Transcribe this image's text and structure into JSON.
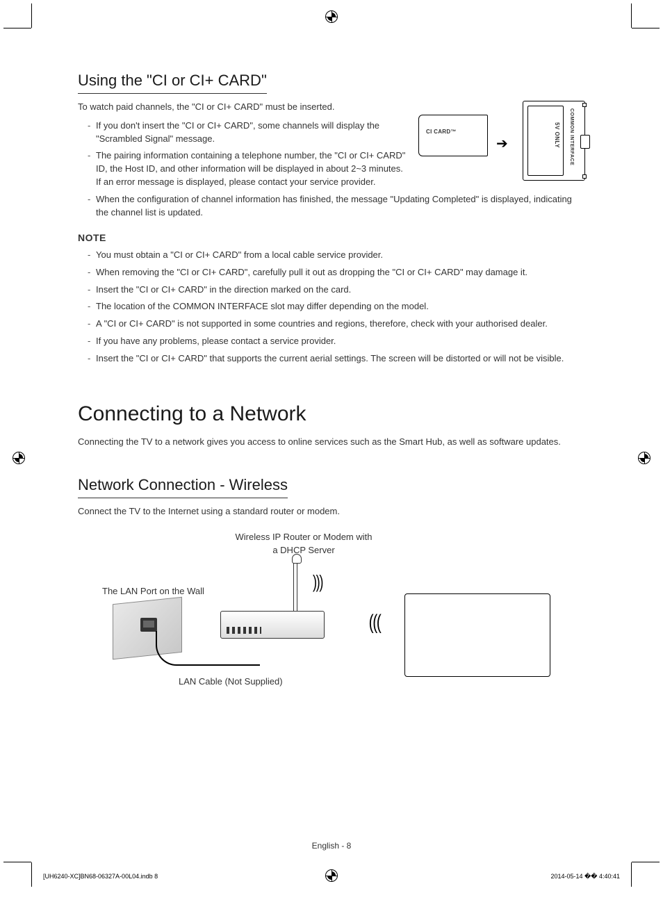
{
  "section1": {
    "heading": "Using the \"CI or CI+ CARD\"",
    "intro": "To watch paid channels, the \"CI or CI+ CARD\" must be inserted.",
    "bullets_a": [
      "If you don't insert the \"CI or CI+ CARD\", some channels will display the \"Scrambled Signal\" message.",
      "The pairing information containing a telephone number, the \"CI or CI+ CARD\" ID, the Host ID, and other information will be displayed in about 2~3 minutes. If an error message is displayed, please contact your service provider."
    ],
    "bullets_b": [
      "When the configuration of channel information has finished, the message \"Updating Completed\" is displayed, indicating the channel list is updated."
    ],
    "note_head": "NOTE",
    "note_bullets": [
      "You must obtain a \"CI or CI+ CARD\" from a local cable service provider.",
      "When removing the \"CI or CI+ CARD\", carefully pull it out as dropping the \"CI or CI+ CARD\" may damage it.",
      "Insert the \"CI or CI+ CARD\" in the direction marked on the card.",
      "The location of the COMMON INTERFACE slot may differ depending on the model.",
      "A \"CI or CI+ CARD\" is not supported in some countries and regions, therefore, check with your authorised dealer.",
      "If you have any problems, please contact a service provider.",
      "Insert the \"CI or CI+ CARD\" that supports the current aerial settings. The screen will be distorted or will not be visible."
    ],
    "figure": {
      "card_label": "CI CARD™",
      "slot_label": "COMMON INTERFACE",
      "voltage_label": "5V ONLY"
    }
  },
  "section2": {
    "main_heading": "Connecting to a Network",
    "main_intro": "Connecting the TV to a network gives you access to online services such as the Smart Hub, as well as software updates.",
    "sub_heading": "Network Connection - Wireless",
    "sub_intro": "Connect the TV to the Internet using a standard router or modem.",
    "figure": {
      "router_caption_line1": "Wireless IP Router or Modem with",
      "router_caption_line2": "a DHCP Server",
      "wall_caption": "The LAN Port on the Wall",
      "lan_caption": "LAN Cable (Not Supplied)"
    }
  },
  "footer": {
    "page_label": "English - 8",
    "doc_ref": "[UH6240-XC]BN68-06327A-00L04.indb   8",
    "timestamp": "2014-05-14   �� 4:40:41"
  }
}
